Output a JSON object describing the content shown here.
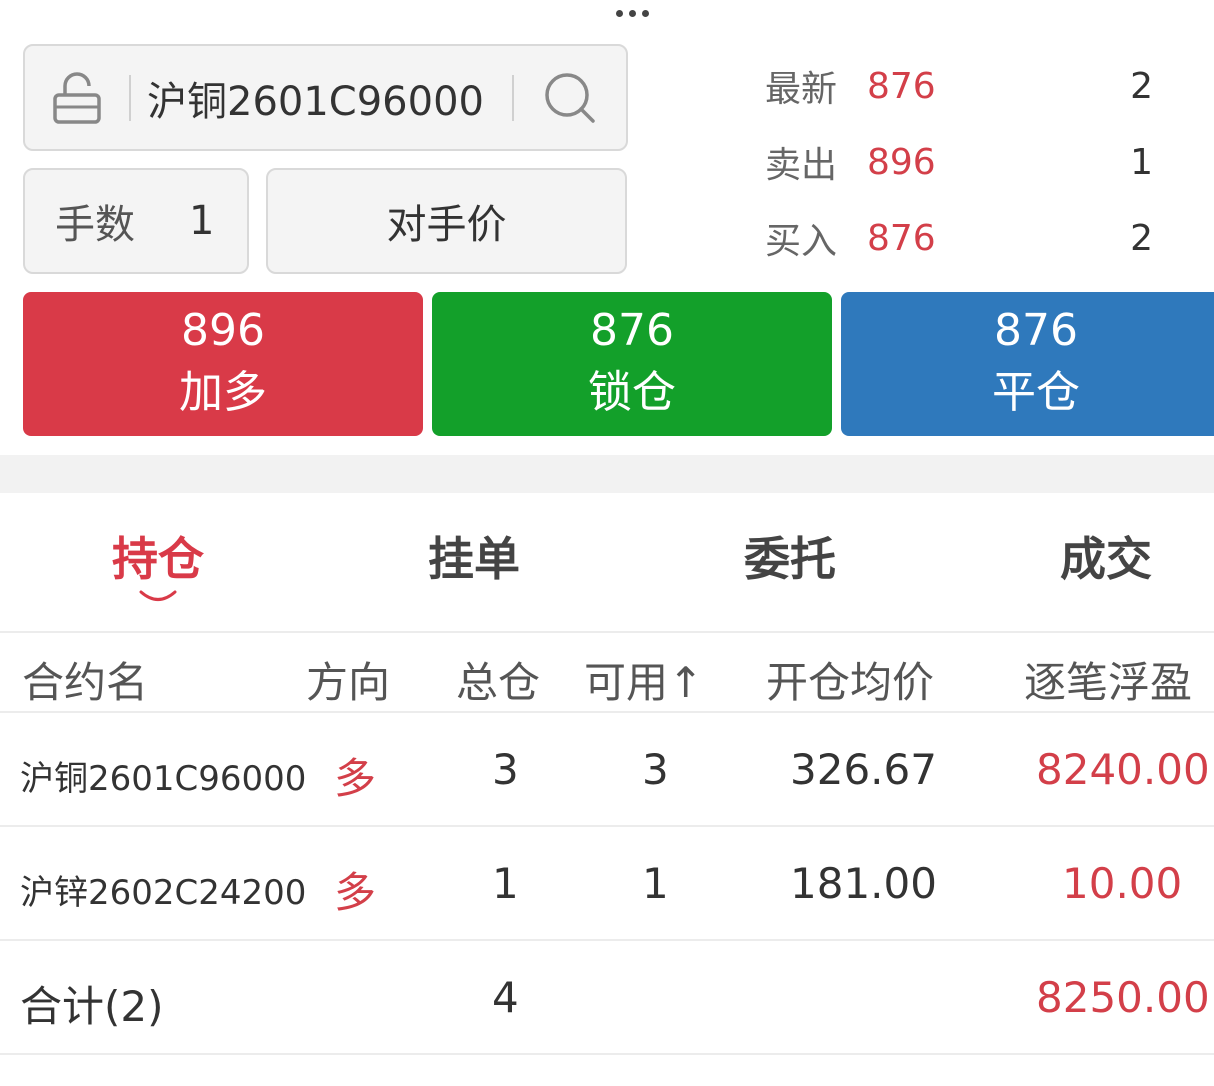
{
  "top": {
    "more_icon": "more-dots-icon"
  },
  "contract": {
    "lock_icon": "lock-open-icon",
    "code": "沪铜2601C96000",
    "search_icon": "search-icon"
  },
  "order": {
    "qty_label": "手数",
    "qty_value": "1",
    "price_type": "对手价"
  },
  "quotes": [
    {
      "label": "最新",
      "price": "876",
      "volume": "2"
    },
    {
      "label": "卖出",
      "price": "896",
      "volume": "1"
    },
    {
      "label": "买入",
      "price": "876",
      "volume": "2"
    }
  ],
  "actions": {
    "buy": {
      "price": "896",
      "label": "加多",
      "color": "#d93a48"
    },
    "lock": {
      "price": "876",
      "label": "锁仓",
      "color": "#13a02a"
    },
    "close": {
      "price": "876",
      "label": "平仓",
      "color": "#2f79bc"
    }
  },
  "tabs": [
    "持仓",
    "挂单",
    "委托",
    "成交"
  ],
  "active_tab": "持仓",
  "table": {
    "headers": [
      "合约名",
      "方向",
      "总仓",
      "可用↑",
      "开仓均价",
      "逐笔浮盈"
    ],
    "rows": [
      {
        "name": "沪铜2601C96000",
        "direction": "多",
        "total": "3",
        "available": "3",
        "avg_price": "326.67",
        "pnl": "8240.00"
      },
      {
        "name": "沪锌2602C24200",
        "direction": "多",
        "total": "1",
        "available": "1",
        "avg_price": "181.00",
        "pnl": "10.00"
      }
    ],
    "summary": {
      "label": "合计(2)",
      "total": "4",
      "pnl": "8250.00"
    }
  }
}
